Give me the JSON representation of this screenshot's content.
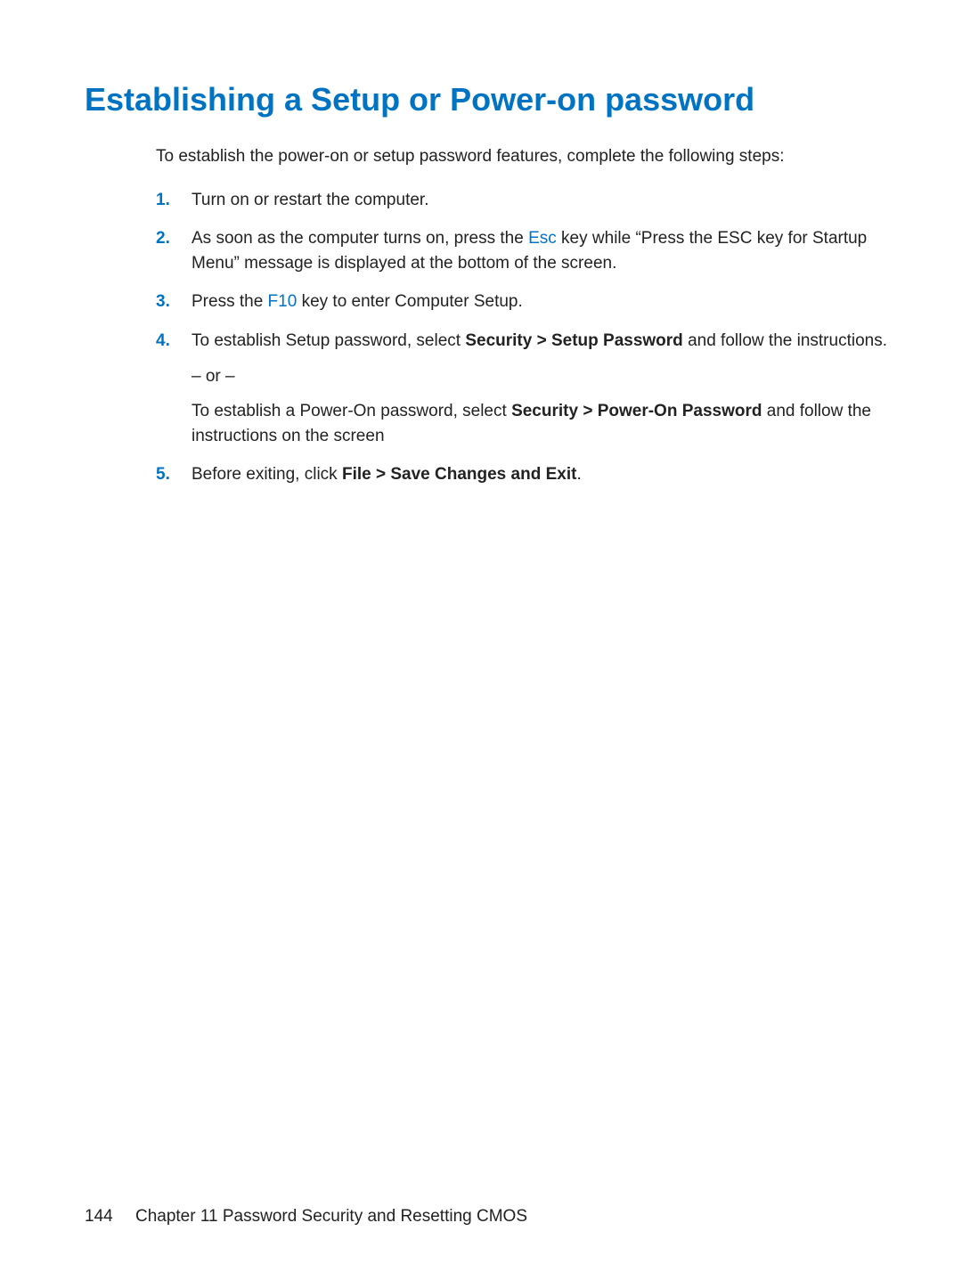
{
  "heading": "Establishing a Setup or Power-on password",
  "intro": "To establish the power-on or setup password features, complete the following steps:",
  "steps": {
    "s1": "Turn on or restart the computer.",
    "s2_a": "As soon as the computer turns on, press the ",
    "s2_key": "Esc",
    "s2_b": " key while “Press the ESC key for Startup Menu” message is displayed at the bottom of the screen.",
    "s3_a": "Press the ",
    "s3_key": "F10",
    "s3_b": " key to enter Computer Setup.",
    "s4_a": "To establish Setup password, select ",
    "s4_b1": "Security > Setup Password",
    "s4_c": " and follow the instructions.",
    "s4_or": "– or –",
    "s4_d": "To establish a Power-On password, select ",
    "s4_b2": "Security > Power-On Password",
    "s4_e": " and follow the instructions on the screen",
    "s5_a": "Before exiting, click ",
    "s5_b": "File > Save Changes and Exit",
    "s5_c": "."
  },
  "footer": {
    "page": "144",
    "chapter": "Chapter 11   Password Security and Resetting CMOS"
  },
  "colors": {
    "accent": "#0073c2"
  }
}
